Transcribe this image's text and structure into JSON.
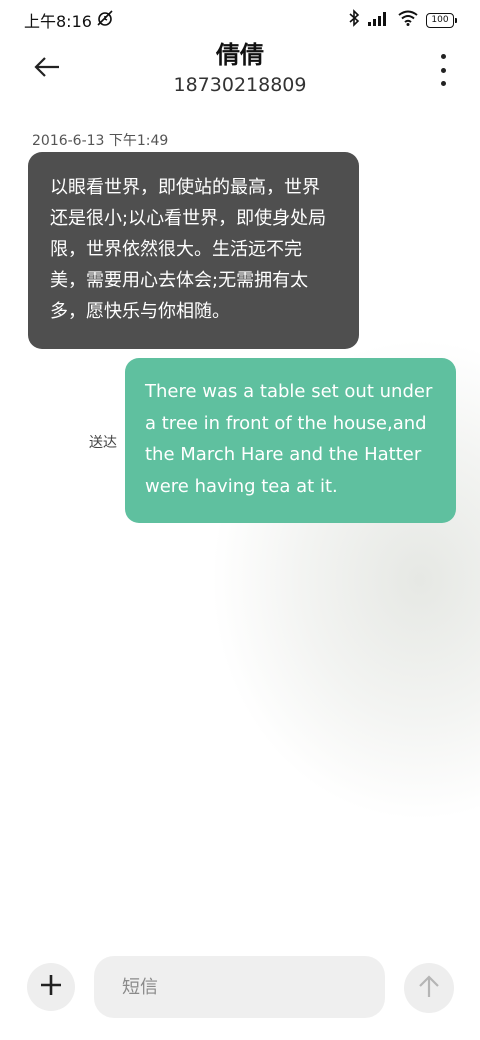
{
  "status_bar": {
    "time": "上午8:16",
    "battery": "100",
    "icons": [
      "alarm-off-icon",
      "bluetooth-icon",
      "signal-icon",
      "wifi-icon",
      "battery-icon"
    ]
  },
  "header": {
    "contact_name": "倩倩",
    "contact_number": "18730218809",
    "icons": [
      "back-arrow-icon",
      "more-vertical-icon"
    ]
  },
  "conversation": {
    "timestamp": "2016-6-13 下午1:49",
    "incoming_message": "以眼看世界，即使站的最高，世界还是很小;以心看世界，即使身处局限，世界依然很大。生活远不完美，需要用心去体会;无需拥有太多，愿快乐与你相随。",
    "outgoing_message": "There was a table set out under a tree in front of the house,and the March Hare and the Hatter were having tea at it.",
    "outgoing_status": "送达"
  },
  "composer": {
    "placeholder": "短信",
    "icons": [
      "plus-icon",
      "send-arrow-icon"
    ]
  },
  "colors": {
    "incoming_bubble": "#4f4f4f",
    "outgoing_bubble": "#5fc09f",
    "input_background": "#efefef"
  }
}
